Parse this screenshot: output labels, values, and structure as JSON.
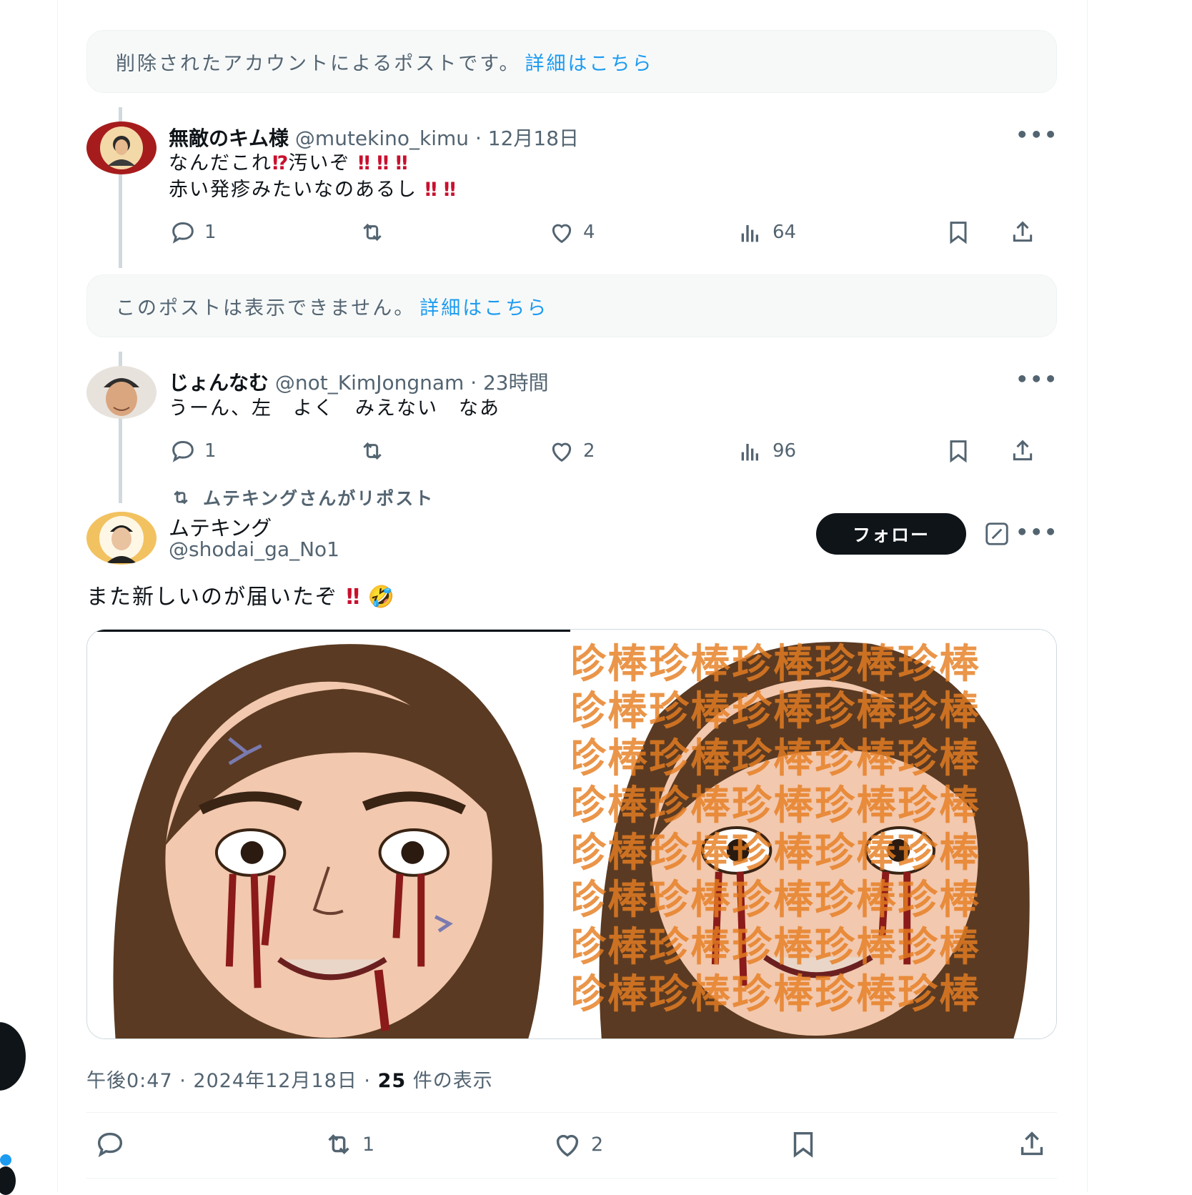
{
  "notice_deleted": {
    "text": "削除されたアカウントによるポストです。",
    "link": "詳細はこちら"
  },
  "post1": {
    "display_name": "無敵のキム様",
    "handle": "@mutekino_kimu",
    "date": "· 12月18日",
    "line1_text": "なんだこれ",
    "line1_mark": "⁉",
    "line1_text2": "汚いぞ",
    "line1_excl": "‼ ‼ ‼",
    "line2_text": "赤い発疹みたいなのあるし",
    "line2_excl": "‼ ‼",
    "more": "•••",
    "replies": "1",
    "reposts": "",
    "likes": "4",
    "views": "64"
  },
  "notice_unavailable": {
    "text": "このポストは表示できません。",
    "link": "詳細はこちら"
  },
  "post2": {
    "display_name": "じょんなむ",
    "handle": "@not_KimJongnam",
    "date": "· 23時間",
    "text": "うーん、左　よく　みえない　なあ",
    "more": "•••",
    "replies": "1",
    "reposts": "",
    "likes": "2",
    "views": "96"
  },
  "main_post": {
    "repost_label": "ムテキングさんがリポスト",
    "display_name": "ムテキング",
    "handle": "@shodai_ga_No1",
    "follow_label": "フォロー",
    "more": "•••",
    "text": "また新しいのが届いたぞ",
    "text_excl": "‼",
    "text_emoji": "🤣",
    "watermark_text": "珍棒珍棒珍棒珍棒珍棒",
    "time": "午後0:47",
    "date": "2024年12月18日",
    "views_count": "25",
    "views_label": "件の表示",
    "replies": "",
    "reposts": "1",
    "likes": "2"
  },
  "colors": {
    "accent": "#1d9bf0",
    "text": "#0f1419",
    "muted": "#536471",
    "alert": "#c8102e",
    "watermark": "#e67e22"
  },
  "icons": [
    "reply-icon",
    "repost-icon",
    "like-icon",
    "views-icon",
    "bookmark-icon",
    "share-icon",
    "grok-icon",
    "more-icon"
  ]
}
